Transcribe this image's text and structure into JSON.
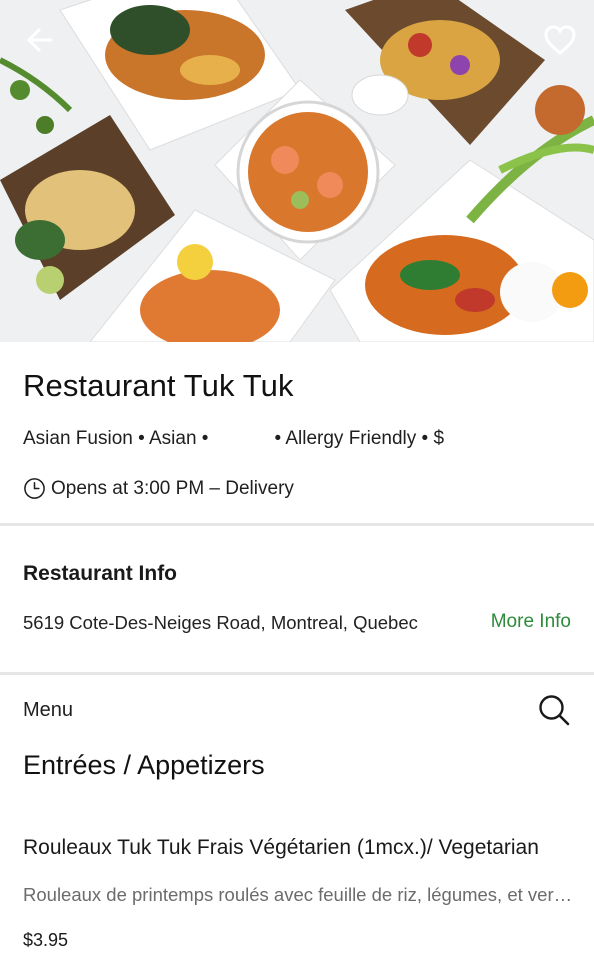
{
  "hero": {
    "image_alt": "",
    "back_icon": "arrow-left-icon",
    "favorite_icon": "heart-outline-icon"
  },
  "restaurant": {
    "name": "Restaurant Tuk Tuk",
    "tags_left": "Asian Fusion • Asian •",
    "tags_right": "• Allergy Friendly • $",
    "hours_icon": "clock-icon",
    "hours": "Opens at 3:00 PM – Delivery"
  },
  "info": {
    "title": "Restaurant Info",
    "address": "5619 Cote-Des-Neiges Road, Montreal, Quebec",
    "more_info_label": "More Info",
    "more_info_color": "#2e8b3a"
  },
  "menu": {
    "label": "Menu",
    "search_icon": "search-icon",
    "category": "Entrées / Appetizers",
    "items": [
      {
        "name": "Rouleaux Tuk Tuk Frais Végétarien (1mcx.)/ Vegetarian",
        "description": "Rouleaux de printemps roulés avec feuille de riz, légumes, et vermicelles",
        "price": "$3.95"
      }
    ]
  }
}
